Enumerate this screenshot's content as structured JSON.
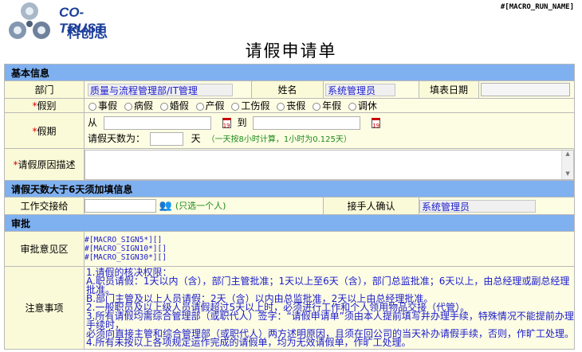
{
  "header": {
    "logo_en": "CO-TRUST",
    "logo_cn": "科创思",
    "macro_run": "#[MACRO_RUN_NAME]",
    "title": "请假申请单"
  },
  "basic": {
    "section_title": "基本信息",
    "dept_label": "部门",
    "dept_value": "质量与流程管理部/IT管理",
    "name_label": "姓名",
    "name_value": "系统管理员",
    "fill_date_label": "填表日期",
    "fill_date_value": "",
    "type_label": "假别",
    "leave_types": [
      "事假",
      "病假",
      "婚假",
      "产假",
      "工伤假",
      "丧假",
      "年假",
      "调休"
    ],
    "period_label": "假期",
    "from_label": "从",
    "to_label": "到",
    "calendar_glyph": "19",
    "days_label": "请假天数为：",
    "days_value": "",
    "days_unit": "天",
    "days_hint": "（一天按8小时计算，1小时为0.125天）",
    "reason_label": "请假原因描述",
    "reason_value": ""
  },
  "extra": {
    "section_title": "请假天数大于6天须加填信息",
    "handover_label": "工作交接给",
    "handover_value": "",
    "select_one": "(只选一个人)",
    "receiver_label": "接手人确认",
    "receiver_value": "系统管理员"
  },
  "approval": {
    "section_title": "审批",
    "opinion_label": "审批意见区",
    "signs": [
      "#[MACRO_SIGN5*][]",
      "#[MACRO_SIGN10*][]",
      "#[MACRO_SIGN30*][]"
    ],
    "notes_label": "注意事项",
    "notes": [
      "1.请假的核决权限：",
      "A.职员请假：1天以内（含），部门主管批准；1天以上至6天（含），部门总监批准；6天以上，由总经理或副总经理批准。",
      "B.部门主管及以上人员请假：2天（含）以内由总监批准，2天以上由总经理批准。",
      "2.一般职员及以上级人员请假超过5天以上时，必须进行工作和个人领用物品交接（代管）。",
      "3.所有请假均需综合管理部（或职代人）签字：“请假申请单”须由本人提前填写并办理手续，特殊情况不能提前办理手续时，",
      "必须向直接主管和综合管理部（或职代人）两方述明原因，且须在回公司的当天补办请假手续，否则，作旷工处理。",
      "4.所有未按以上各项规定运作完成的请假单，均为无效请假单，作旷工处理。"
    ]
  },
  "colors": {
    "section_bg": "#7fb0f0",
    "label_bg": "#fbfad8",
    "accent_blue": "#1a1acc",
    "required_red": "#e00000",
    "hint_green": "#1c8a1c"
  }
}
